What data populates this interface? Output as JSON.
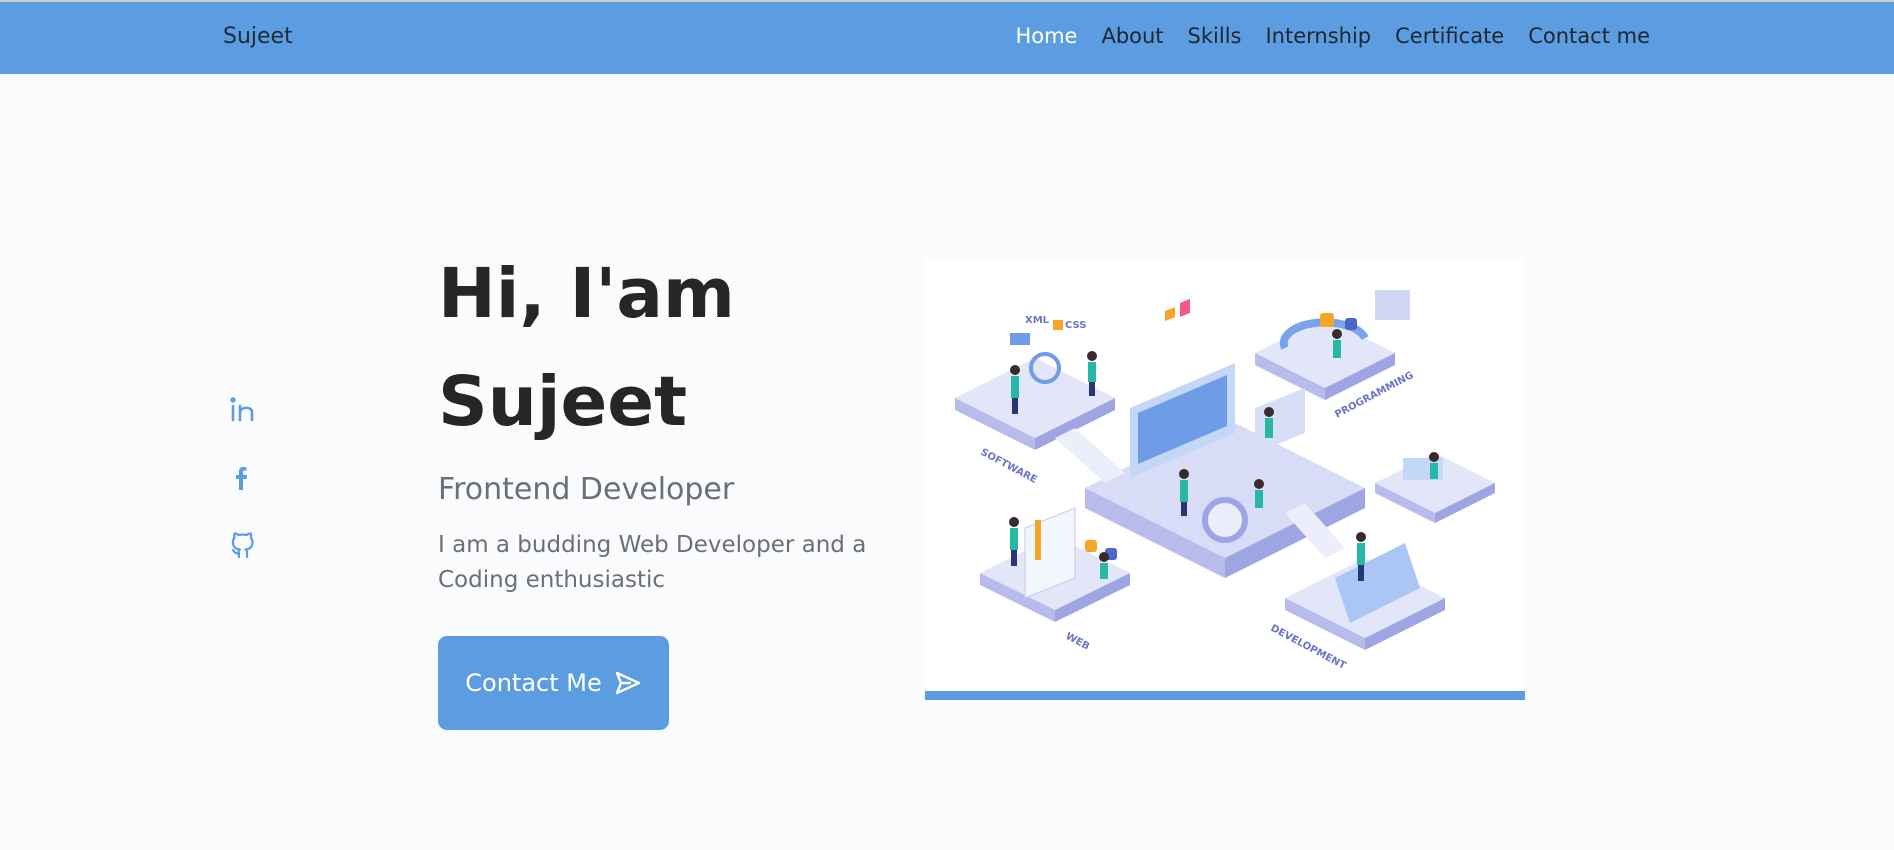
{
  "header": {
    "logo": "Sujeet",
    "nav": [
      {
        "label": "Home",
        "active": true
      },
      {
        "label": "About"
      },
      {
        "label": "Skills"
      },
      {
        "label": "Internship"
      },
      {
        "label": "Certificate"
      },
      {
        "label": "Contact me"
      }
    ]
  },
  "social": [
    {
      "icon": "linkedin-icon"
    },
    {
      "icon": "facebook-icon"
    },
    {
      "icon": "github-icon"
    }
  ],
  "hero": {
    "title_line1": "Hi, I'am",
    "title_line2": "Sujeet",
    "subtitle": "Frontend Developer",
    "description": "I am a budding Web Developer and a Coding enthusiastic",
    "cta_label": "Contact Me"
  },
  "illustration": {
    "labels": [
      "SOFTWARE",
      "PROGRAMMING",
      "WEB",
      "DEVELOPMENT",
      "XML",
      "CSS"
    ]
  },
  "colors": {
    "accent": "#5b9de0",
    "background": "#f9fbfd",
    "heading": "#262626",
    "muted": "#6b6f76"
  }
}
